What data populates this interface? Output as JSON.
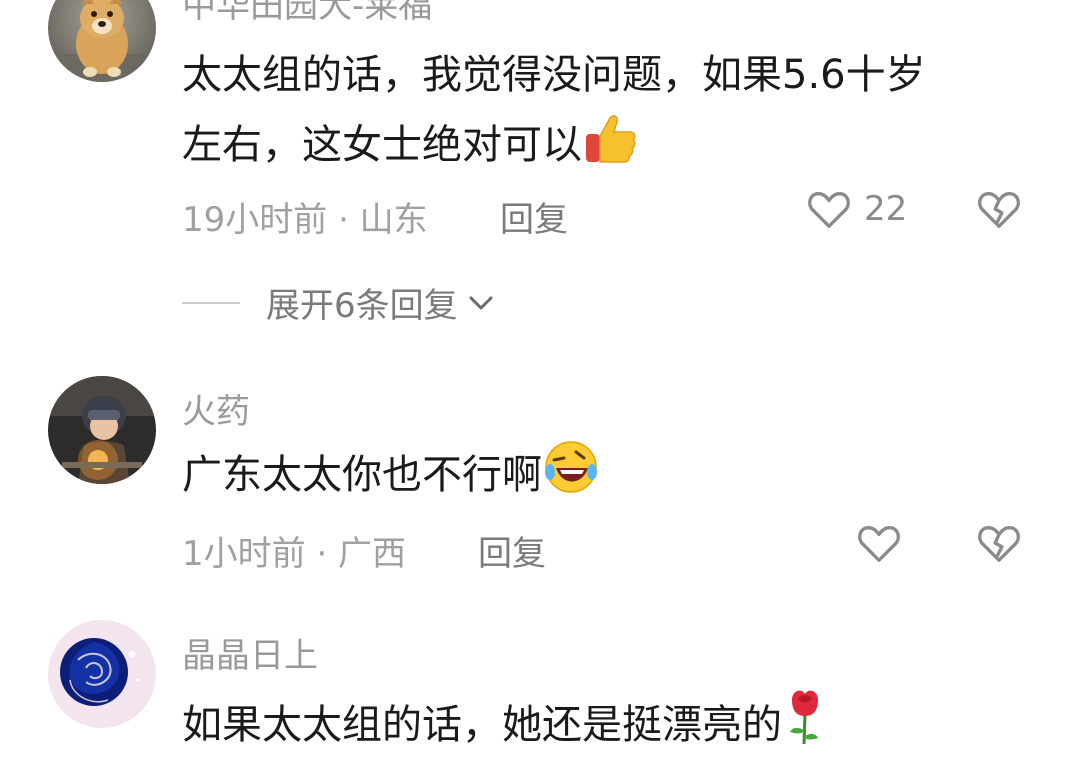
{
  "comments": [
    {
      "username": "中华田园犬-莱福",
      "text_line1": "太太组的话，我觉得没问题，如果5.6十岁",
      "text_line2": "左右，这女士绝对可以",
      "emoji": "thumbs-up",
      "time_location": "19小时前 · 山东",
      "reply_label": "回复",
      "like_count": "22",
      "expand_label": "展开6条回复"
    },
    {
      "username": "火药",
      "text_line1": "广东太太你也不行啊",
      "emoji": "rolling-laughing",
      "time_location": "1小时前 · 广西",
      "reply_label": "回复"
    },
    {
      "username": "晶晶日上",
      "text_line1": "如果太太组的话，她还是挺漂亮的",
      "emoji": "rose"
    }
  ],
  "icons": {
    "like": "heart-outline-icon",
    "dislike": "broken-heart-icon",
    "expand": "chevron-down-icon"
  },
  "colors": {
    "text_primary": "#1a1a1a",
    "text_secondary": "#9a9a9a",
    "icon_gray": "#8a8a8a"
  }
}
